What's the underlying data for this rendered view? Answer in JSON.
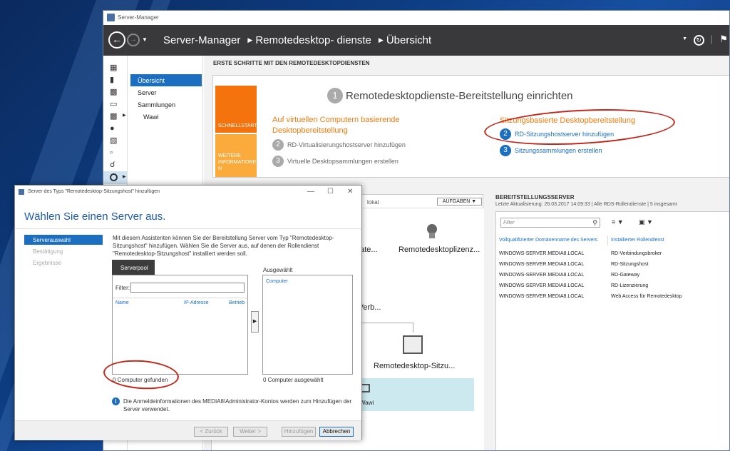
{
  "window": {
    "title": "Server-Manager"
  },
  "header": {
    "breadcrumb": [
      "Server-Manager",
      "Remotedesktop- dienste",
      "Übersicht"
    ]
  },
  "left_nav": {
    "items": [
      {
        "label": "Übersicht",
        "selected": true
      },
      {
        "label": "Server",
        "selected": false
      },
      {
        "label": "Sammlungen",
        "selected": false
      },
      {
        "label": "Wawi",
        "selected": false
      }
    ]
  },
  "main": {
    "section_title": "ERSTE SCHRITTE MIT DEN REMOTEDESKTOPDIENSTEN",
    "quickstart_label": "SCHNELLSTART",
    "more_info_label": "WEITERE INFORMATIONE N",
    "wizard_number": "1",
    "wizard_title": "Remotedesktopdienste-Bereitstellung einrichten",
    "left_heading": "Auf virtuellen Computern basierende Desktopbereitstellung",
    "left_steps": [
      {
        "num": "2",
        "label": "RD-Virtualisierungshostserver hinzufügen"
      },
      {
        "num": "3",
        "label": "Virtuelle Desktopsammlungen erstellen"
      }
    ],
    "right_heading": "Sitzungsbasierte Desktopbereitstellung",
    "right_steps": [
      {
        "num": "2",
        "label": "RD-Sitzungshostserver hinzufügen"
      },
      {
        "num": "3",
        "label": "Sitzungssammlungen erstellen"
      }
    ]
  },
  "roles_pane": {
    "scope_label": "lokal",
    "tasks_button": "AUFGABEN",
    "diagram_labels": {
      "gateway": "gate...",
      "license": "Remotedesktoplizenz...",
      "broker": "-Verb...",
      "session_host": "Remotedesktop-Sitzu...",
      "collection": "Wawi"
    }
  },
  "deployment_servers": {
    "title": "BEREITSTELLUNGSSERVER",
    "subtitle": "Letzte Aktualisierung: 26.03.2017 14:09:33 | Alle RDS-Rollendienste | 5 insgesamt",
    "filter_placeholder": "Filter",
    "columns": [
      "Vollqualifizierter Domänenname des Servers",
      "Installierter Rollendienst"
    ],
    "rows": [
      [
        "WINDOWS-SERVER.MEDIA8.LOCAL",
        "RD-Verbindungsbroker"
      ],
      [
        "WINDOWS-SERVER.MEDIA8.LOCAL",
        "RD-Sitzungshost"
      ],
      [
        "WINDOWS-SERVER.MEDIA8.LOCAL",
        "RD-Gateway"
      ],
      [
        "WINDOWS-SERVER.MEDIA8.LOCAL",
        "RD-Lizenzierung"
      ],
      [
        "WINDOWS-SERVER.MEDIA8.LOCAL",
        "Web Access für Remotedesktop"
      ]
    ]
  },
  "dialog": {
    "title": "Server des Typs \"Remotedesktop-Sitzungshost\" hinzufügen",
    "heading": "Wählen Sie einen Server aus.",
    "steps": [
      {
        "label": "Serverauswahl",
        "selected": true
      },
      {
        "label": "Bestätigung",
        "selected": false
      },
      {
        "label": "Ergebnisse",
        "selected": false
      }
    ],
    "description": "Mit diesem Assistenten können Sie der Bereitstellung Server vom Typ \"Remotedesktop-Sitzungshost\" hinzufügen. Wählen Sie die Server aus, auf denen der Rollendienst \"Remotedesktop-Sitzungshost\" installiert werden soll.",
    "pool_tab": "Serverpool",
    "filter_label": "Filter:",
    "filter_value": "",
    "pool_columns": [
      "Name",
      "IP-Adresse",
      "Betrieb"
    ],
    "found_text": "0 Computer gefunden",
    "selected_label": "Ausgewählt",
    "selected_column": "Computer",
    "selected_count": "0 Computer ausgewählt",
    "info_text": "Die Anmeldeinformationen des MEDIA8\\Administrator-Kontos werden zum Hinzufügen der Server verwendet.",
    "buttons": {
      "back": "< Zurück",
      "next": "Weiter >",
      "add": "Hinzufügen",
      "cancel": "Abbrechen"
    }
  },
  "colors": {
    "accent_blue": "#1c6fc0",
    "quickstart_orange": "#f4730c",
    "info_orange": "#fbab3b",
    "header_dark": "#39393b",
    "annotation_red": "#c0281c"
  }
}
